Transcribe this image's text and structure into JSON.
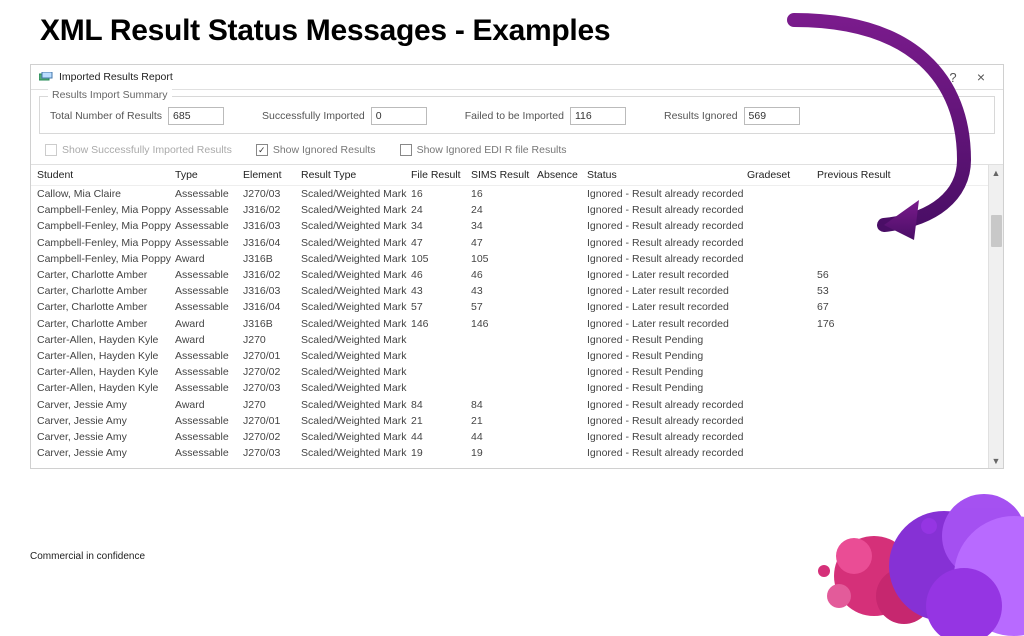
{
  "slide_title": "XML Result Status Messages - Examples",
  "footer": "Commercial in confidence",
  "window": {
    "title": "Imported Results Report",
    "help": "?",
    "close": "×"
  },
  "summary": {
    "legend": "Results Import Summary",
    "total_label": "Total Number of Results",
    "total_value": "685",
    "success_label": "Successfully Imported",
    "success_value": "0",
    "failed_label": "Failed to be Imported",
    "failed_value": "116",
    "ignored_label": "Results Ignored",
    "ignored_value": "569"
  },
  "filters": {
    "show_success": "Show Successfully Imported Results",
    "show_ignored": "Show Ignored Results",
    "show_ignored_edi": "Show Ignored EDI R file Results"
  },
  "columns": [
    "Student",
    "Type",
    "Element",
    "Result Type",
    "File Result",
    "SIMS Result",
    "Absence",
    "Status",
    "Gradeset",
    "Previous Result"
  ],
  "rows": [
    {
      "student": "Callow, Mia Claire",
      "type": "Assessable",
      "element": "J270/03",
      "rtype": "Scaled/Weighted Mark",
      "file": "16",
      "sims": "16",
      "absence": "",
      "status": "Ignored - Result already recorded",
      "gradeset": "",
      "prev": ""
    },
    {
      "student": "Campbell-Fenley, Mia Poppy",
      "type": "Assessable",
      "element": "J316/02",
      "rtype": "Scaled/Weighted Mark",
      "file": "24",
      "sims": "24",
      "absence": "",
      "status": "Ignored - Result already recorded",
      "gradeset": "",
      "prev": ""
    },
    {
      "student": "Campbell-Fenley, Mia Poppy",
      "type": "Assessable",
      "element": "J316/03",
      "rtype": "Scaled/Weighted Mark",
      "file": "34",
      "sims": "34",
      "absence": "",
      "status": "Ignored - Result already recorded",
      "gradeset": "",
      "prev": ""
    },
    {
      "student": "Campbell-Fenley, Mia Poppy",
      "type": "Assessable",
      "element": "J316/04",
      "rtype": "Scaled/Weighted Mark",
      "file": "47",
      "sims": "47",
      "absence": "",
      "status": "Ignored - Result already recorded",
      "gradeset": "",
      "prev": ""
    },
    {
      "student": "Campbell-Fenley, Mia Poppy",
      "type": "Award",
      "element": "J316B",
      "rtype": "Scaled/Weighted Mark",
      "file": "105",
      "sims": "105",
      "absence": "",
      "status": "Ignored - Result already recorded",
      "gradeset": "",
      "prev": ""
    },
    {
      "student": "Carter, Charlotte Amber",
      "type": "Assessable",
      "element": "J316/02",
      "rtype": "Scaled/Weighted Mark",
      "file": "46",
      "sims": "46",
      "absence": "",
      "status": "Ignored - Later result recorded",
      "gradeset": "",
      "prev": "56"
    },
    {
      "student": "Carter, Charlotte Amber",
      "type": "Assessable",
      "element": "J316/03",
      "rtype": "Scaled/Weighted Mark",
      "file": "43",
      "sims": "43",
      "absence": "",
      "status": "Ignored - Later result recorded",
      "gradeset": "",
      "prev": "53"
    },
    {
      "student": "Carter, Charlotte Amber",
      "type": "Assessable",
      "element": "J316/04",
      "rtype": "Scaled/Weighted Mark",
      "file": "57",
      "sims": "57",
      "absence": "",
      "status": "Ignored - Later result recorded",
      "gradeset": "",
      "prev": "67"
    },
    {
      "student": "Carter, Charlotte Amber",
      "type": "Award",
      "element": "J316B",
      "rtype": "Scaled/Weighted Mark",
      "file": "146",
      "sims": "146",
      "absence": "",
      "status": "Ignored - Later result recorded",
      "gradeset": "",
      "prev": "176"
    },
    {
      "student": "Carter-Allen, Hayden Kyle",
      "type": "Award",
      "element": "J270",
      "rtype": "Scaled/Weighted Mark",
      "file": "",
      "sims": "",
      "absence": "",
      "status": "Ignored - Result Pending",
      "gradeset": "",
      "prev": ""
    },
    {
      "student": "Carter-Allen, Hayden Kyle",
      "type": "Assessable",
      "element": "J270/01",
      "rtype": "Scaled/Weighted Mark",
      "file": "",
      "sims": "",
      "absence": "",
      "status": "Ignored - Result Pending",
      "gradeset": "",
      "prev": ""
    },
    {
      "student": "Carter-Allen, Hayden Kyle",
      "type": "Assessable",
      "element": "J270/02",
      "rtype": "Scaled/Weighted Mark",
      "file": "",
      "sims": "",
      "absence": "",
      "status": "Ignored - Result Pending",
      "gradeset": "",
      "prev": ""
    },
    {
      "student": "Carter-Allen, Hayden Kyle",
      "type": "Assessable",
      "element": "J270/03",
      "rtype": "Scaled/Weighted Mark",
      "file": "",
      "sims": "",
      "absence": "",
      "status": "Ignored - Result Pending",
      "gradeset": "",
      "prev": ""
    },
    {
      "student": "Carver, Jessie Amy",
      "type": "Award",
      "element": "J270",
      "rtype": "Scaled/Weighted Mark",
      "file": "84",
      "sims": "84",
      "absence": "",
      "status": "Ignored - Result already recorded",
      "gradeset": "",
      "prev": ""
    },
    {
      "student": "Carver, Jessie Amy",
      "type": "Assessable",
      "element": "J270/01",
      "rtype": "Scaled/Weighted Mark",
      "file": "21",
      "sims": "21",
      "absence": "",
      "status": "Ignored - Result already recorded",
      "gradeset": "",
      "prev": ""
    },
    {
      "student": "Carver, Jessie Amy",
      "type": "Assessable",
      "element": "J270/02",
      "rtype": "Scaled/Weighted Mark",
      "file": "44",
      "sims": "44",
      "absence": "",
      "status": "Ignored - Result already recorded",
      "gradeset": "",
      "prev": ""
    },
    {
      "student": "Carver, Jessie Amy",
      "type": "Assessable",
      "element": "J270/03",
      "rtype": "Scaled/Weighted Mark",
      "file": "19",
      "sims": "19",
      "absence": "",
      "status": "Ignored - Result already recorded",
      "gradeset": "",
      "prev": ""
    }
  ]
}
